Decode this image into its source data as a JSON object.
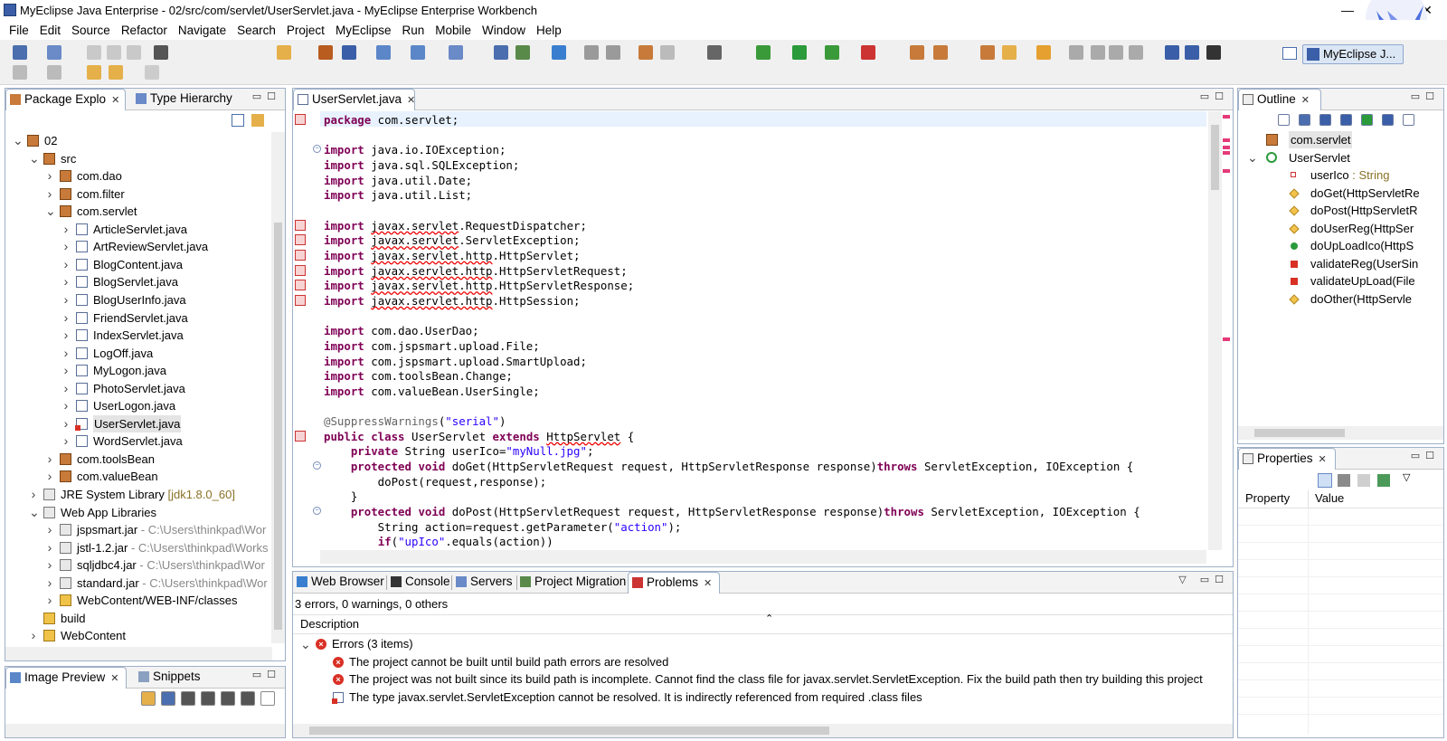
{
  "window": {
    "title": "MyEclipse Java Enterprise - 02/src/com/servlet/UserServlet.java - MyEclipse Enterprise Workbench",
    "controls": [
      "—",
      "☐",
      "✕"
    ]
  },
  "menu": [
    "File",
    "Edit",
    "Source",
    "Refactor",
    "Navigate",
    "Search",
    "Project",
    "MyEclipse",
    "Run",
    "Mobile",
    "Window",
    "Help"
  ],
  "perspective": {
    "label": "MyEclipse J..."
  },
  "package_explorer": {
    "tabs": [
      "Package Explo",
      "Type Hierarchy"
    ],
    "tree": [
      {
        "label": "02",
        "indent": 0,
        "arrow": "v",
        "icon": "project"
      },
      {
        "label": "src",
        "indent": 1,
        "arrow": "v",
        "icon": "srcfolder"
      },
      {
        "label": "com.dao",
        "indent": 2,
        "arrow": ">",
        "icon": "package"
      },
      {
        "label": "com.filter",
        "indent": 2,
        "arrow": ">",
        "icon": "package"
      },
      {
        "label": "com.servlet",
        "indent": 2,
        "arrow": "v",
        "icon": "package"
      },
      {
        "label": "ArticleServlet.java",
        "indent": 3,
        "arrow": ">",
        "icon": "java"
      },
      {
        "label": "ArtReviewServlet.java",
        "indent": 3,
        "arrow": ">",
        "icon": "java"
      },
      {
        "label": "BlogContent.java",
        "indent": 3,
        "arrow": ">",
        "icon": "java"
      },
      {
        "label": "BlogServlet.java",
        "indent": 3,
        "arrow": ">",
        "icon": "java"
      },
      {
        "label": "BlogUserInfo.java",
        "indent": 3,
        "arrow": ">",
        "icon": "java"
      },
      {
        "label": "FriendServlet.java",
        "indent": 3,
        "arrow": ">",
        "icon": "java"
      },
      {
        "label": "IndexServlet.java",
        "indent": 3,
        "arrow": ">",
        "icon": "java"
      },
      {
        "label": "LogOff.java",
        "indent": 3,
        "arrow": ">",
        "icon": "java"
      },
      {
        "label": "MyLogon.java",
        "indent": 3,
        "arrow": ">",
        "icon": "java"
      },
      {
        "label": "PhotoServlet.java",
        "indent": 3,
        "arrow": ">",
        "icon": "java"
      },
      {
        "label": "UserLogon.java",
        "indent": 3,
        "arrow": ">",
        "icon": "java"
      },
      {
        "label": "UserServlet.java",
        "indent": 3,
        "arrow": ">",
        "icon": "java-error",
        "selected": true
      },
      {
        "label": "WordServlet.java",
        "indent": 3,
        "arrow": ">",
        "icon": "java"
      },
      {
        "label": "com.toolsBean",
        "indent": 2,
        "arrow": ">",
        "icon": "package"
      },
      {
        "label": "com.valueBean",
        "indent": 2,
        "arrow": ">",
        "icon": "package"
      },
      {
        "label": "JRE System Library",
        "suffix": "[jdk1.8.0_60]",
        "suffix_style": "olive",
        "indent": 1,
        "arrow": ">",
        "icon": "library"
      },
      {
        "label": "Web App Libraries",
        "indent": 1,
        "arrow": "v",
        "icon": "library"
      },
      {
        "label": "jspsmart.jar",
        "suffix": "- C:\\Users\\thinkpad\\Wor",
        "suffix_style": "gray",
        "indent": 2,
        "arrow": ">",
        "icon": "jar"
      },
      {
        "label": "jstl-1.2.jar",
        "suffix": "- C:\\Users\\thinkpad\\Works",
        "suffix_style": "gray",
        "indent": 2,
        "arrow": ">",
        "icon": "jar"
      },
      {
        "label": "sqljdbc4.jar",
        "suffix": "- C:\\Users\\thinkpad\\Wor",
        "suffix_style": "gray",
        "indent": 2,
        "arrow": ">",
        "icon": "jar"
      },
      {
        "label": "standard.jar",
        "suffix": "- C:\\Users\\thinkpad\\Wor",
        "suffix_style": "gray",
        "indent": 2,
        "arrow": ">",
        "icon": "jar"
      },
      {
        "label": "WebContent/WEB-INF/classes",
        "indent": 2,
        "arrow": ">",
        "icon": "folder"
      },
      {
        "label": "build",
        "indent": 1,
        "arrow": "",
        "icon": "folder"
      },
      {
        "label": "WebContent",
        "indent": 1,
        "arrow": ">",
        "icon": "folder"
      }
    ]
  },
  "image_preview": {
    "tabs": [
      "Image Preview",
      "Snippets"
    ]
  },
  "editor": {
    "tab": "UserServlet.java",
    "lines": [
      [
        [
          "kw",
          "package"
        ],
        [
          "n",
          " com.servlet;"
        ]
      ],
      [],
      [
        [
          "kw",
          "import"
        ],
        [
          "n",
          " java.io.IOException;"
        ]
      ],
      [
        [
          "kw",
          "import"
        ],
        [
          "n",
          " java.sql.SQLException;"
        ]
      ],
      [
        [
          "kw",
          "import"
        ],
        [
          "n",
          " java.util.Date;"
        ]
      ],
      [
        [
          "kw",
          "import"
        ],
        [
          "n",
          " java.util.List;"
        ]
      ],
      [],
      [
        [
          "kw",
          "import"
        ],
        [
          "n",
          " "
        ],
        [
          "err",
          "javax.servlet"
        ],
        [
          "n",
          ".RequestDispatcher;"
        ]
      ],
      [
        [
          "kw",
          "import"
        ],
        [
          "n",
          " "
        ],
        [
          "err",
          "javax.servlet"
        ],
        [
          "n",
          ".ServletException;"
        ]
      ],
      [
        [
          "kw",
          "import"
        ],
        [
          "n",
          " "
        ],
        [
          "err",
          "javax.servlet.http"
        ],
        [
          "n",
          ".HttpServlet;"
        ]
      ],
      [
        [
          "kw",
          "import"
        ],
        [
          "n",
          " "
        ],
        [
          "err",
          "javax.servlet.http"
        ],
        [
          "n",
          ".HttpServletRequest;"
        ]
      ],
      [
        [
          "kw",
          "import"
        ],
        [
          "n",
          " "
        ],
        [
          "err",
          "javax.servlet.http"
        ],
        [
          "n",
          ".HttpServletResponse;"
        ]
      ],
      [
        [
          "kw",
          "import"
        ],
        [
          "n",
          " "
        ],
        [
          "err",
          "javax.servlet.http"
        ],
        [
          "n",
          ".HttpSession;"
        ]
      ],
      [],
      [
        [
          "kw",
          "import"
        ],
        [
          "n",
          " com.dao.UserDao;"
        ]
      ],
      [
        [
          "kw",
          "import"
        ],
        [
          "n",
          " com.jspsmart.upload.File;"
        ]
      ],
      [
        [
          "kw",
          "import"
        ],
        [
          "n",
          " com.jspsmart.upload.SmartUpload;"
        ]
      ],
      [
        [
          "kw",
          "import"
        ],
        [
          "n",
          " com.toolsBean.Change;"
        ]
      ],
      [
        [
          "kw",
          "import"
        ],
        [
          "n",
          " com.valueBean.UserSingle;"
        ]
      ],
      [],
      [
        [
          "ann",
          "@SuppressWarnings"
        ],
        [
          "n",
          "("
        ],
        [
          "str",
          "\"serial\""
        ],
        [
          "n",
          ")"
        ]
      ],
      [
        [
          "kw",
          "public class"
        ],
        [
          "n",
          " UserServlet "
        ],
        [
          "kw",
          "extends"
        ],
        [
          "n",
          " "
        ],
        [
          "err",
          "HttpServlet"
        ],
        [
          "n",
          " {"
        ]
      ],
      [
        [
          "n",
          "    "
        ],
        [
          "kw",
          "private"
        ],
        [
          "n",
          " String userIco="
        ],
        [
          "str",
          "\"myNull.jpg\""
        ],
        [
          "n",
          ";"
        ]
      ],
      [
        [
          "n",
          "    "
        ],
        [
          "kw",
          "protected void"
        ],
        [
          "n",
          " doGet(HttpServletRequest request, HttpServletResponse response)"
        ],
        [
          "kw",
          "throws"
        ],
        [
          "n",
          " ServletException, IOException {"
        ]
      ],
      [
        [
          "n",
          "        doPost(request,response);"
        ]
      ],
      [
        [
          "n",
          "    }"
        ]
      ],
      [
        [
          "n",
          "    "
        ],
        [
          "kw",
          "protected void"
        ],
        [
          "n",
          " doPost(HttpServletRequest request, HttpServletResponse response)"
        ],
        [
          "kw",
          "throws"
        ],
        [
          "n",
          " ServletException, IOException {"
        ]
      ],
      [
        [
          "n",
          "        String action=request.getParameter("
        ],
        [
          "str",
          "\"action\""
        ],
        [
          "n",
          ");"
        ]
      ],
      [
        [
          "n",
          "        "
        ],
        [
          "kw",
          "if"
        ],
        [
          "n",
          "("
        ],
        [
          "str",
          "\"upIco\""
        ],
        [
          "n",
          ".equals(action))"
        ]
      ]
    ]
  },
  "outline": {
    "tab": "Outline",
    "items": [
      {
        "label": "com.servlet",
        "indent": 0,
        "icon": "package",
        "selected": true
      },
      {
        "label": "UserServlet",
        "indent": 0,
        "icon": "class",
        "arrow": "v"
      },
      {
        "label": "userIco",
        "suffix": " : String",
        "indent": 1,
        "icon": "private-field"
      },
      {
        "label": "doGet(HttpServletRe",
        "indent": 1,
        "icon": "protected"
      },
      {
        "label": "doPost(HttpServletR",
        "indent": 1,
        "icon": "protected"
      },
      {
        "label": "doUserReg(HttpSer",
        "indent": 1,
        "icon": "protected"
      },
      {
        "label": "doUpLoadIco(HttpS",
        "indent": 1,
        "icon": "public"
      },
      {
        "label": "validateReg(UserSin",
        "indent": 1,
        "icon": "private"
      },
      {
        "label": "validateUpLoad(File",
        "indent": 1,
        "icon": "private"
      },
      {
        "label": "doOther(HttpServle",
        "indent": 1,
        "icon": "protected"
      }
    ]
  },
  "properties": {
    "tab": "Properties",
    "columns": [
      "Property",
      "Value"
    ]
  },
  "bottom": {
    "tabs": [
      "Web Browser",
      "Console",
      "Servers",
      "Project Migration",
      "Problems"
    ],
    "summary": "3 errors, 0 warnings, 0 others",
    "column": "Description",
    "group": "Errors (3 items)",
    "rows": [
      {
        "text": "The project cannot be built until build path errors are resolved",
        "icon": "error"
      },
      {
        "text": "The project was not built since its build path is incomplete. Cannot find the class file for javax.servlet.ServletException. Fix the build path then try building this project",
        "icon": "error"
      },
      {
        "text": "The type javax.servlet.ServletException cannot be resolved. It is indirectly referenced from required .class files",
        "icon": "java-error"
      }
    ]
  },
  "colors": {
    "keyword": "#7f0055",
    "string": "#2a00ff",
    "annotation": "#646464",
    "error": "#d93025",
    "selection": "#cde3f7",
    "panel_border": "#9fb0c8"
  }
}
